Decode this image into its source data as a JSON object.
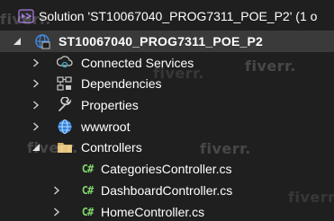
{
  "solution": {
    "label": "Solution 'ST10067040_PROG7311_POE_P2' (1 o",
    "icon": "solution-icon"
  },
  "project": {
    "label": "ST10067040_PROG7311_POE_P2",
    "icon": "web-project-icon"
  },
  "nodes": [
    {
      "label": "Connected Services",
      "icon": "connected-services-icon"
    },
    {
      "label": "Dependencies",
      "icon": "dependencies-icon"
    },
    {
      "label": "Properties",
      "icon": "wrench-icon"
    },
    {
      "label": "wwwroot",
      "icon": "globe-icon"
    },
    {
      "label": "Controllers",
      "icon": "folder-icon"
    }
  ],
  "controllers": [
    {
      "label": "CategoriesController.cs",
      "icon": "csharp-file-icon",
      "badge": "C#"
    },
    {
      "label": "DashboardController.cs",
      "icon": "csharp-file-icon",
      "badge": "C#"
    },
    {
      "label": "HomeController.cs",
      "icon": "csharp-file-icon",
      "badge": "C#"
    }
  ],
  "watermarks": [
    "fiverr.",
    "fiverr.",
    "fiverr.",
    "fiverr.",
    "fiverr.",
    "fiverr."
  ],
  "colors": {
    "background": "#1f1f1f",
    "selected_row": "#3a3a3a",
    "solution_accent": "#a87be8",
    "globe": "#3f8fe8",
    "folder": "#d8b265",
    "csharp": "#7fd36a"
  }
}
